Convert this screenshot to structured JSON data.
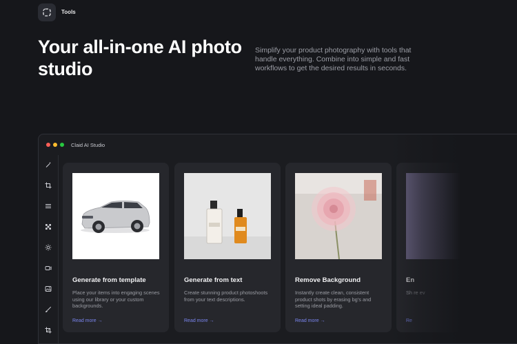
{
  "header": {
    "tools_label": "Tools"
  },
  "hero": {
    "title": "Your all-in-one AI photo studio",
    "description": "Simplify your product photography with tools that handle everything. Combine into simple and fast workflows to get the desired results in seconds."
  },
  "app": {
    "window_title": "Claid AI Studio",
    "traffic_lights": [
      "#ff5f57",
      "#febc2e",
      "#28c840"
    ],
    "sidebar_icons": [
      "magic-wand-icon",
      "crop-icon",
      "layers-icon",
      "checkerboard-icon",
      "sun-icon",
      "camera-icon",
      "image-icon",
      "brush-icon",
      "resize-icon"
    ]
  },
  "cards": [
    {
      "title": "Generate from template",
      "description": "Place your items into engaging scenes using our library or your custom backgrounds.",
      "link": "Read more →"
    },
    {
      "title": "Generate from text",
      "description": "Create stunning product photoshoots from your text descriptions.",
      "link": "Read more →"
    },
    {
      "title": "Remove Background",
      "description": "Instantly create clean, consistent product shots by erasing bg's and setting ideal padding.",
      "link": "Read more →"
    },
    {
      "title": "En",
      "description": "Sh re ev",
      "link": "Re"
    }
  ],
  "colors": {
    "background": "#16171b",
    "card": "#26272c",
    "accent_link": "#7b86f0"
  }
}
